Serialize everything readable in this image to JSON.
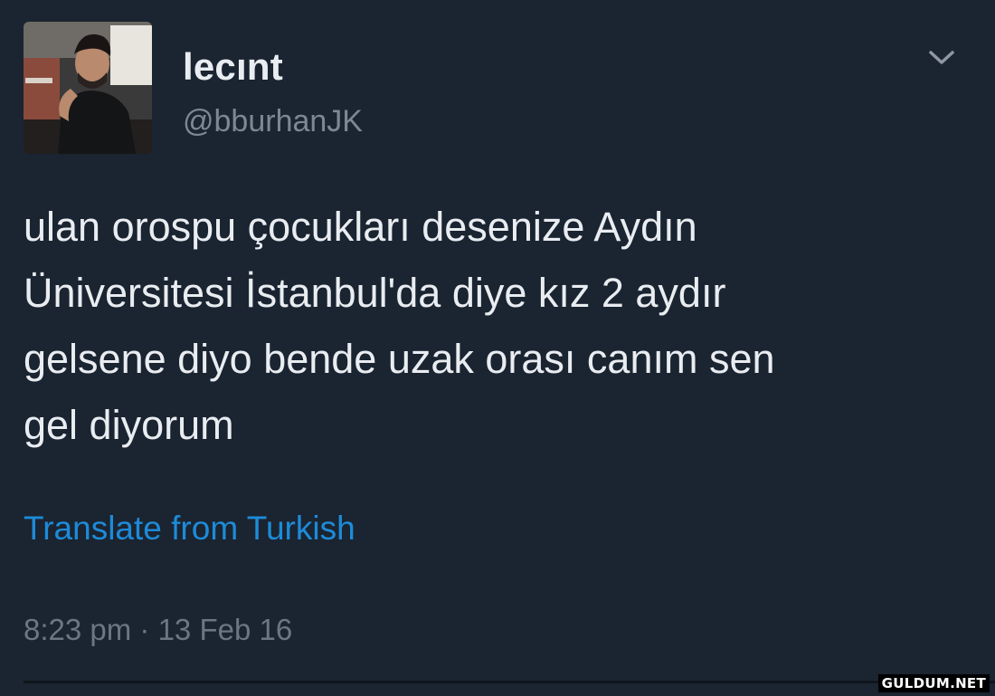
{
  "tweet": {
    "display_name": "lecınt",
    "handle": "@bburhanJK",
    "text": "ulan orospu çocukları desenize Aydın\nÜniversitesi İstanbul'da diye kız 2 aydır\ngelsene diyo bende uzak orası canım sen\ngel diyorum",
    "translate_label": "Translate from Turkish",
    "timestamp": "8:23 pm · 13 Feb 16"
  },
  "watermark": "GULDUM.NET",
  "icons": {
    "avatar": "profile-photo",
    "menu": "chevron-down-icon"
  },
  "colors": {
    "background": "#1b2431",
    "primary_text": "#e9edf1",
    "secondary_text": "#7c8893",
    "link": "#1d8bd8"
  }
}
